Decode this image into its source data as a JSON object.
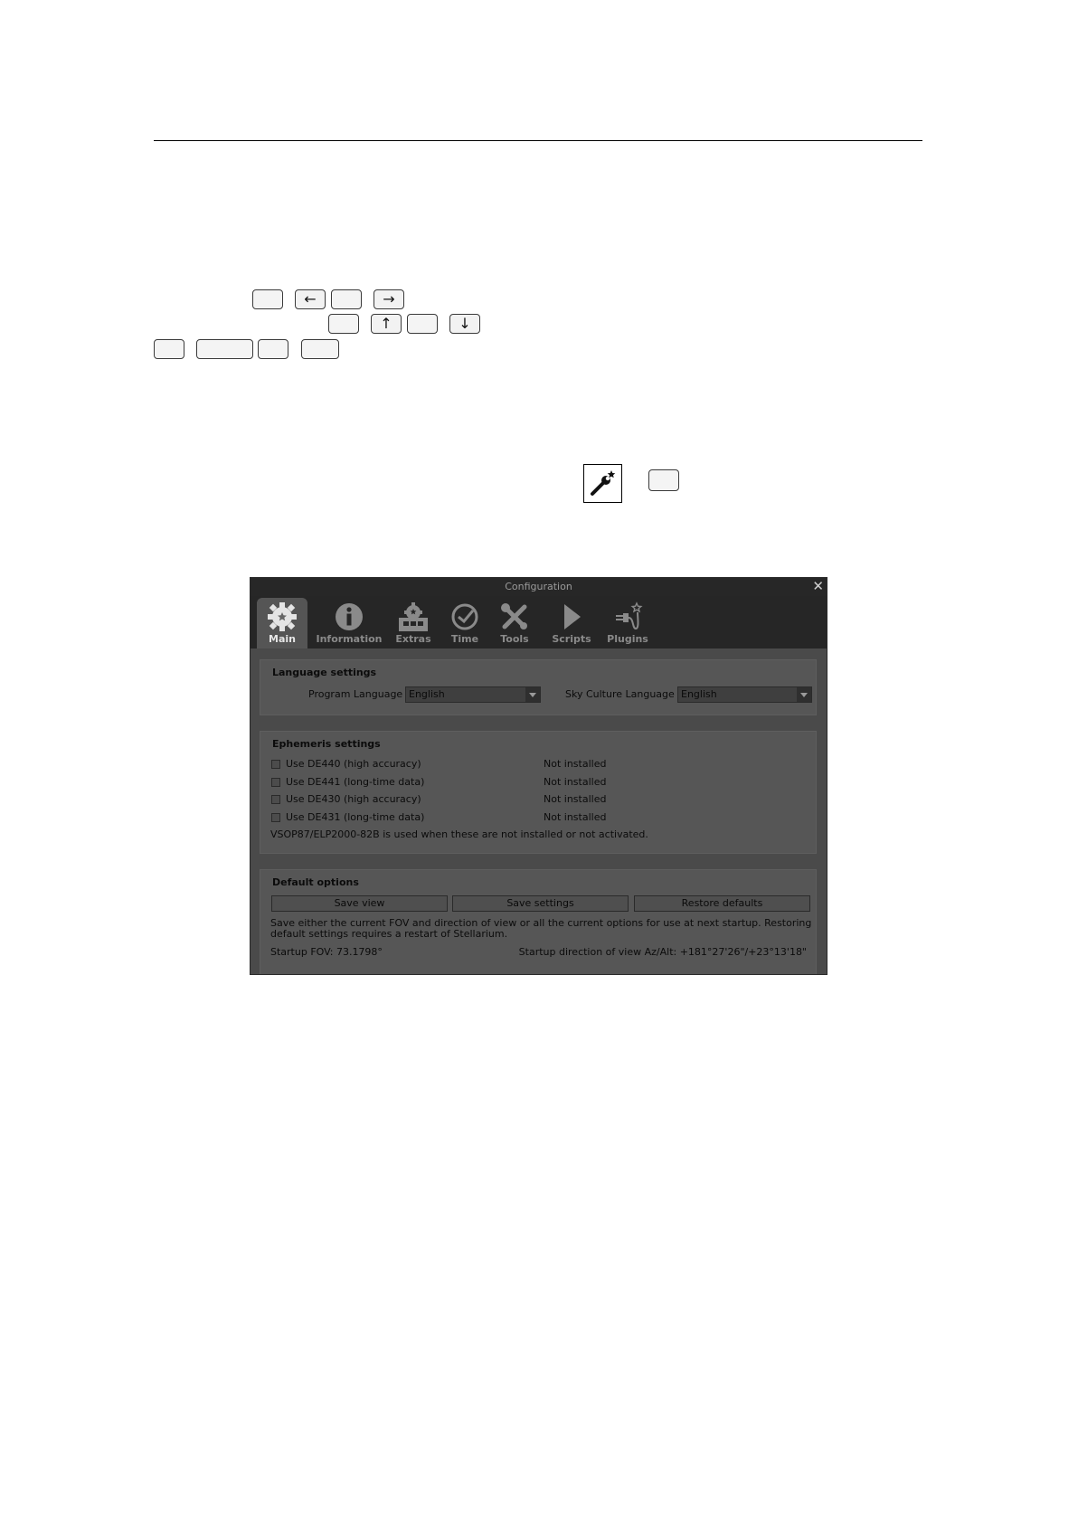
{
  "page": {
    "arrow_keys": {
      "left": "←",
      "right": "→",
      "up": "↑",
      "down": "↓"
    }
  },
  "dialog": {
    "title": "Configuration",
    "tabs": [
      {
        "label": "Main",
        "icon": "gear-icon",
        "active": true
      },
      {
        "label": "Information",
        "icon": "info-icon",
        "active": false
      },
      {
        "label": "Extras",
        "icon": "extras-icon",
        "active": false
      },
      {
        "label": "Time",
        "icon": "clock-icon",
        "active": false
      },
      {
        "label": "Tools",
        "icon": "tools-icon",
        "active": false
      },
      {
        "label": "Scripts",
        "icon": "play-icon",
        "active": false
      },
      {
        "label": "Plugins",
        "icon": "plugin-icon",
        "active": false
      }
    ],
    "language": {
      "title": "Language settings",
      "program_label": "Program Language",
      "program_value": "English",
      "sky_label": "Sky Culture Language",
      "sky_value": "English"
    },
    "ephemeris": {
      "title": "Ephemeris settings",
      "items": [
        {
          "label": "Use DE440 (high accuracy)",
          "status": "Not installed",
          "checked": false
        },
        {
          "label": "Use DE441 (long-time data)",
          "status": "Not installed",
          "checked": false
        },
        {
          "label": "Use DE430 (high accuracy)",
          "status": "Not installed",
          "checked": false
        },
        {
          "label": "Use DE431 (long-time data)",
          "status": "Not installed",
          "checked": false
        }
      ],
      "note": "VSOP87/ELP2000-82B is used when these are not installed or not activated."
    },
    "defaults": {
      "title": "Default options",
      "save_view": "Save view",
      "save_settings": "Save settings",
      "restore_defaults": "Restore defaults",
      "description_line1": "Save either the current FOV and direction of view or all the current options for use at next startup. Restoring",
      "description_line2": "default settings requires a restart of Stellarium.",
      "startup_fov": "Startup FOV: 73.1798°",
      "startup_direction": "Startup direction of view Az/Alt: +181°27'26\"/+23°13'18\""
    },
    "colors": {
      "title_bar": "#272727",
      "tab_bar": "#262626",
      "panel": "#565656",
      "background": "#4a4a4a"
    }
  }
}
